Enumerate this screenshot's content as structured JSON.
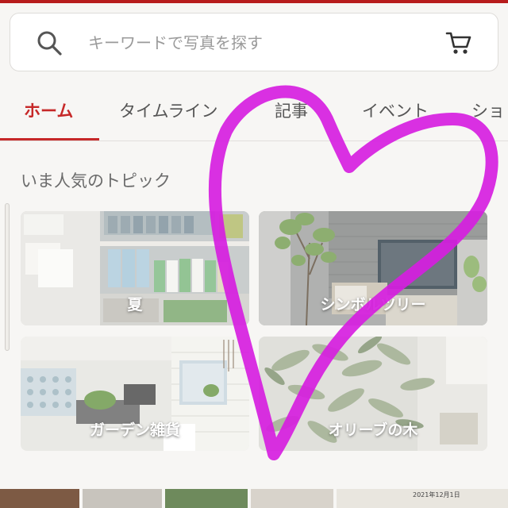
{
  "search": {
    "placeholder": "キーワードで写真を探す",
    "value": ""
  },
  "icons": {
    "search": "search-icon",
    "cart": "cart-icon"
  },
  "tabs": [
    {
      "label": "ホーム",
      "active": true
    },
    {
      "label": "タイムライン",
      "active": false
    },
    {
      "label": "記事",
      "active": false
    },
    {
      "label": "イベント",
      "active": false
    },
    {
      "label": "ショ",
      "active": false
    }
  ],
  "topics": {
    "title": "いま人気のトピック",
    "items": [
      {
        "label": "夏"
      },
      {
        "label": "シンボルツリー"
      },
      {
        "label": "ガーデン雑貨"
      },
      {
        "label": "オリーブの木"
      }
    ]
  },
  "bottom_strip": {
    "date_text": "2021年12月1日"
  },
  "colors": {
    "accent": "#c62828",
    "background": "#f7f6f4",
    "overlay_heart": "#d61ee0"
  }
}
